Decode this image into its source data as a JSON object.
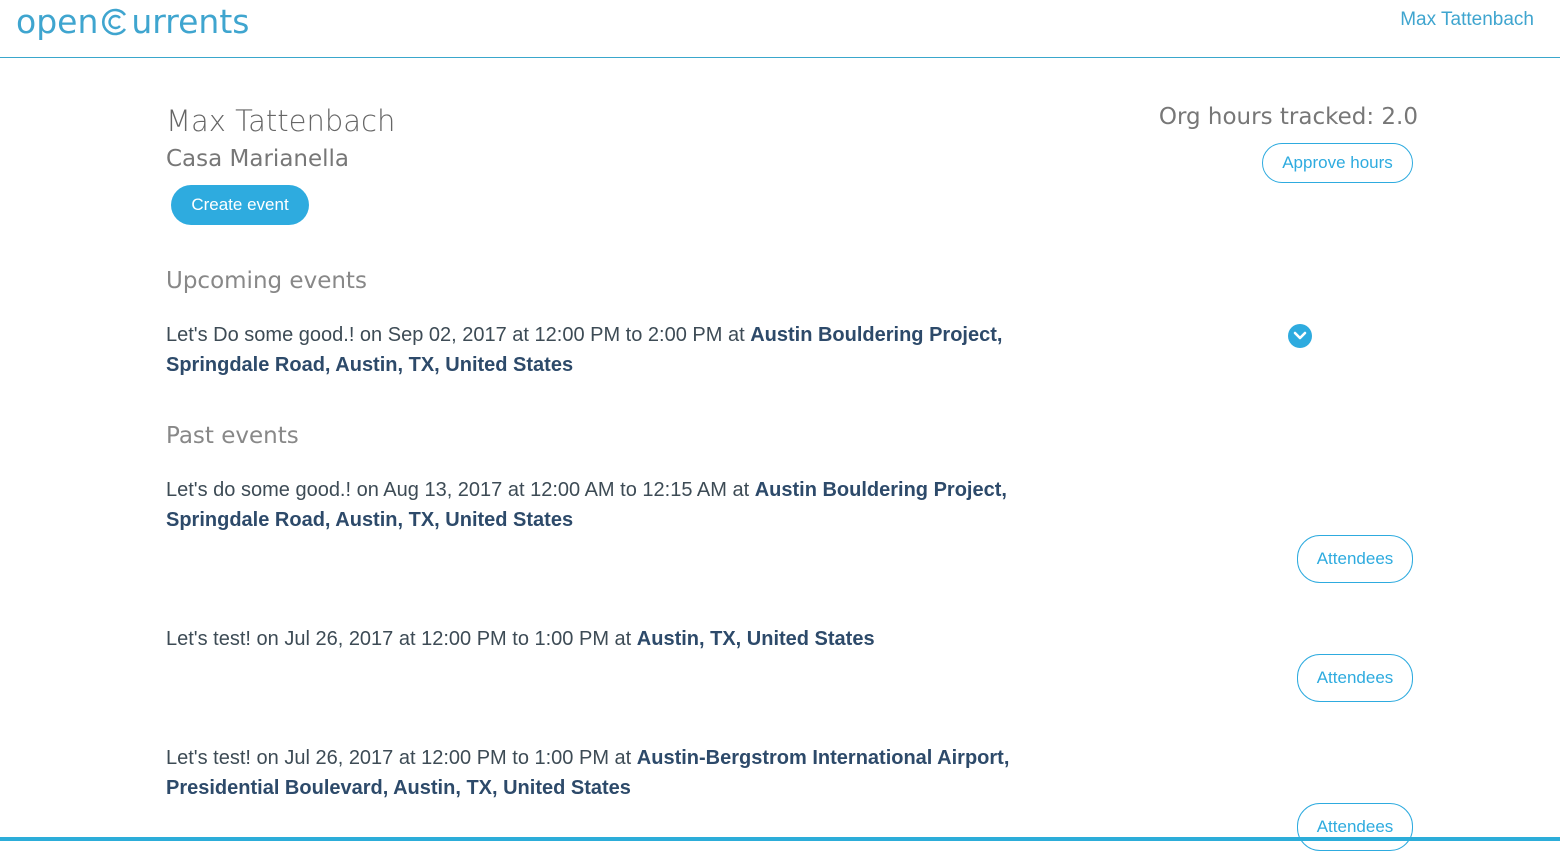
{
  "header": {
    "logo_left": "open",
    "logo_right": "urrents",
    "user_name": "Max Tattenbach"
  },
  "profile": {
    "name": "Max Tattenbach",
    "org": "Casa Marianella",
    "create_event_label": "Create event",
    "hours_tracked": "Org hours tracked: 2.0",
    "approve_hours_label": "Approve hours"
  },
  "upcoming": {
    "title": "Upcoming events",
    "events": [
      {
        "prefix": "Let's Do some good.! on Sep 02, 2017 at 12:00 PM to 2:00 PM at ",
        "location": "Austin Bouldering Project, Springdale Road, Austin, TX, United States",
        "icon": "chevron-down-circle-icon"
      }
    ]
  },
  "past": {
    "title": "Past events",
    "attendees_label": "Attendees",
    "events": [
      {
        "prefix": "Let's do some good.! on Aug 13, 2017 at 12:00 AM to 12:15 AM at ",
        "location": "Austin Bouldering Project, Springdale Road, Austin, TX, United States"
      },
      {
        "prefix": "Let's test! on Jul 26, 2017 at 12:00 PM to 1:00 PM at ",
        "location": "Austin, TX, United States"
      },
      {
        "prefix": "Let's test! on Jul 26, 2017 at 12:00 PM to 1:00 PM at ",
        "location": "Austin-Bergstrom International Airport, Presidential Boulevard, Austin, TX, United States"
      }
    ]
  },
  "colors": {
    "accent": "#2eabdf",
    "logo": "#3fa5cf",
    "location_text": "#2d4a6a"
  }
}
